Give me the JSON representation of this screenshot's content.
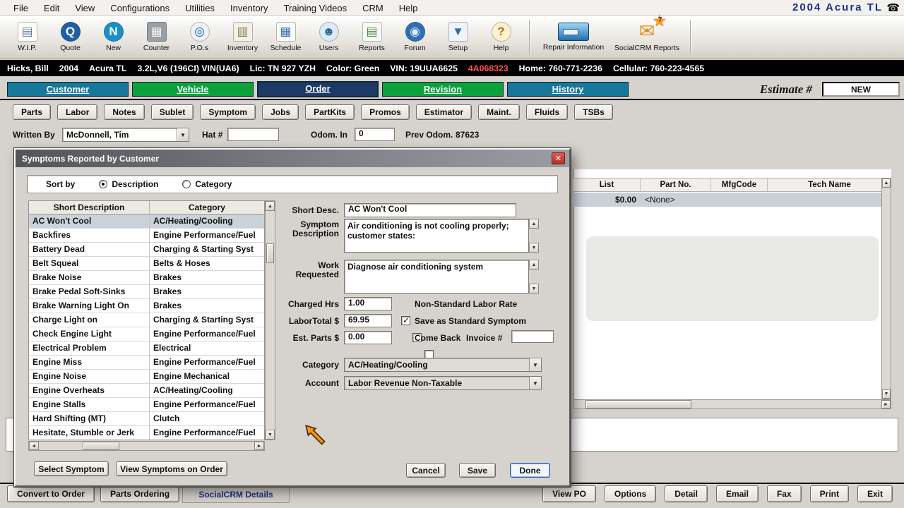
{
  "icons": {
    "dropdown": "▼",
    "up_arrow": "▲",
    "down_arrow": "▼",
    "left_arrow": "◄",
    "right_arrow": "►",
    "close": "✕",
    "phone": "☎",
    "envelope": "✉",
    "star": "★"
  },
  "menu": {
    "items": [
      "File",
      "Edit",
      "View",
      "Configurations",
      "Utilities",
      "Inventory",
      "Training Videos",
      "CRM",
      "Help"
    ],
    "vehicle": "2004  Acura  TL"
  },
  "toolbar": {
    "buttons": [
      {
        "label": "W.I.P.",
        "name": "wip-button",
        "icon_name": "notepad-icon",
        "icon": "▤",
        "bg": "#fdfdf8",
        "fg": "#5b79a8",
        "radius": "3px"
      },
      {
        "label": "Quote",
        "name": "quote-button",
        "icon_name": "quote-icon",
        "icon": "Q",
        "bg": "#1e5fa8",
        "fg": "#ffffff",
        "radius": "50%"
      },
      {
        "label": "New",
        "name": "new-button",
        "icon_name": "new-document-icon",
        "icon": "N",
        "bg": "#1791c8",
        "fg": "#ffffff",
        "radius": "50%"
      },
      {
        "label": "Counter",
        "name": "counter-button",
        "icon_name": "counter-icon",
        "icon": "▦",
        "bg": "#98a0a6",
        "fg": "#f4f4f0",
        "radius": "3px"
      },
      {
        "label": "P.O.s",
        "name": "pos-button",
        "icon_name": "purchase-order-icon",
        "icon": "◎",
        "bg": "#edf2f8",
        "fg": "#1e5fa8",
        "radius": "50%"
      },
      {
        "label": "Inventory",
        "name": "inventory-button",
        "icon_name": "inventory-box-icon",
        "icon": "▥",
        "bg": "#f2f0e8",
        "fg": "#8a7a4a",
        "radius": "3px"
      },
      {
        "label": "Schedule",
        "name": "schedule-button",
        "icon_name": "calendar-icon",
        "icon": "▦",
        "bg": "#f6f8fa",
        "fg": "#3f6fae",
        "radius": "3px"
      },
      {
        "label": "Users",
        "name": "users-button",
        "icon_name": "users-icon",
        "icon": "☻",
        "bg": "#dcebf6",
        "fg": "#2b5f98",
        "radius": "50%"
      },
      {
        "label": "Reports",
        "name": "reports-button",
        "icon_name": "report-icon",
        "icon": "▤",
        "bg": "#f8f8f4",
        "fg": "#4a8a4a",
        "radius": "3px"
      },
      {
        "label": "Forum",
        "name": "forum-button",
        "icon_name": "globe-icon",
        "icon": "◉",
        "bg": "#2e6fb2",
        "fg": "#d8eafc",
        "radius": "50%"
      },
      {
        "label": "Setup",
        "name": "setup-button",
        "icon_name": "funnel-icon",
        "icon": "▼",
        "bg": "#f0f4f8",
        "fg": "#2e6fb2",
        "radius": "3px"
      },
      {
        "label": "Help",
        "name": "help-button",
        "icon_name": "question-icon",
        "icon": "?",
        "bg": "#fdf2cf",
        "fg": "#a8761f",
        "radius": "50%"
      }
    ],
    "repair_info_label": "Repair Information",
    "socialcrm_label": "SocialCRM Reports",
    "socialcrm_badge": "7"
  },
  "customer_bar": {
    "segments": [
      {
        "t": "Hicks, Bill"
      },
      {
        "t": "2004"
      },
      {
        "t": "Acura TL"
      },
      {
        "t": "3.2L,V6 (196CI) VIN(UA6)"
      },
      {
        "t": "Lic:  TN 927 YZH"
      },
      {
        "t": "Color:  Green"
      },
      {
        "t": "VIN:  19UUA6625"
      },
      {
        "t": "4A068323",
        "red": true
      },
      {
        "t": "Home:  760-771-2236"
      },
      {
        "t": "Cellular:  760-223-4565"
      }
    ]
  },
  "main_tabs": [
    {
      "label": "Customer",
      "name": "tab-customer",
      "bg": "#16789b"
    },
    {
      "label": "Vehicle",
      "name": "tab-vehicle",
      "bg": "#0ba23c"
    },
    {
      "label": "Order",
      "name": "tab-order",
      "bg": "#1d3a66",
      "selected": true
    },
    {
      "label": "Revision",
      "name": "tab-revision",
      "bg": "#0ba23c"
    },
    {
      "label": "History",
      "name": "tab-history",
      "bg": "#16789b"
    }
  ],
  "estimate": {
    "label": "Estimate #",
    "value": "NEW"
  },
  "sub_tabs": [
    {
      "label": "Parts",
      "name": "subtab-parts"
    },
    {
      "label": "Labor",
      "name": "subtab-labor"
    },
    {
      "label": "Notes",
      "name": "subtab-notes"
    },
    {
      "label": "Sublet",
      "name": "subtab-sublet"
    },
    {
      "label": "Symptom",
      "name": "subtab-symptom"
    },
    {
      "label": "Jobs",
      "name": "subtab-jobs"
    },
    {
      "label": "PartKits",
      "name": "subtab-partkits"
    },
    {
      "label": "Promos",
      "name": "subtab-promos"
    },
    {
      "label": "Estimator",
      "name": "subtab-estimator"
    },
    {
      "label": "Maint.",
      "name": "subtab-maint"
    },
    {
      "label": "Fluids",
      "name": "subtab-fluids"
    },
    {
      "label": "TSBs",
      "name": "subtab-tsbs"
    }
  ],
  "order_header": {
    "written_by_label": "Written By",
    "written_by_value": "McDonnell, Tim",
    "hat_label": "Hat #",
    "hat_value": "",
    "odom_in_label": "Odom. In",
    "odom_in_value": "0",
    "prev_odom_label": "Prev Odom.",
    "prev_odom_value": "87623"
  },
  "background_grid": {
    "headers": [
      "List",
      "Part No.",
      "MfgCode",
      "Tech Name"
    ],
    "row": {
      "col1": "$0.00",
      "col2": "<None>"
    }
  },
  "dialog": {
    "title": "Symptoms Reported by Customer",
    "sort_label": "Sort by",
    "sort_options": [
      {
        "label": "Description",
        "selected": true
      },
      {
        "label": "Category",
        "selected": false
      }
    ],
    "table": {
      "headers": [
        "Short Description",
        "Category"
      ],
      "rows": [
        {
          "desc": "AC Won't Cool",
          "cat": "AC/Heating/Cooling",
          "selected": true
        },
        {
          "desc": "Backfires",
          "cat": "Engine Performance/Fuel"
        },
        {
          "desc": "Battery Dead",
          "cat": "Charging & Starting Syst"
        },
        {
          "desc": "Belt Squeal",
          "cat": "Belts & Hoses"
        },
        {
          "desc": "Brake Noise",
          "cat": "Brakes"
        },
        {
          "desc": "Brake Pedal Soft-Sinks",
          "cat": "Brakes"
        },
        {
          "desc": "Brake Warning Light On",
          "cat": "Brakes"
        },
        {
          "desc": "Charge Light on",
          "cat": "Charging & Starting Syst"
        },
        {
          "desc": "Check Engine Light",
          "cat": "Engine Performance/Fuel"
        },
        {
          "desc": "Electrical Problem",
          "cat": "Electrical"
        },
        {
          "desc": "Engine Miss",
          "cat": "Engine Performance/Fuel"
        },
        {
          "desc": "Engine Noise",
          "cat": "Engine Mechanical"
        },
        {
          "desc": "Engine Overheats",
          "cat": "AC/Heating/Cooling"
        },
        {
          "desc": "Engine Stalls",
          "cat": "Engine Performance/Fuel"
        },
        {
          "desc": "Hard Shifting (MT)",
          "cat": "Clutch"
        },
        {
          "desc": "Hesitate, Stumble or Jerk",
          "cat": "Engine Performance/Fuel"
        }
      ]
    },
    "form": {
      "short_desc_label": "Short Desc.",
      "short_desc_value": "AC Won't Cool",
      "symptom_desc_label": "Symptom Description",
      "symptom_desc_value": "Air conditioning is not cooling properly; customer states:",
      "work_requested_label": "Work Requested",
      "work_requested_value": "Diagnose air conditioning system",
      "charged_hrs_label": "Charged Hrs",
      "charged_hrs_value": "1.00",
      "labor_total_label": "LaborTotal $",
      "labor_total_value": "69.95",
      "est_parts_label": "Est. Parts $",
      "est_parts_value": "0.00",
      "non_standard_label": "Non-Standard Labor Rate",
      "non_standard_checked": true,
      "save_standard_label": "Save as Standard Symptom",
      "save_standard_checked": false,
      "come_back_label": "Come Back",
      "come_back_checked": false,
      "invoice_label": "Invoice #",
      "invoice_value": "",
      "category_label": "Category",
      "category_value": "AC/Heating/Cooling",
      "account_label": "Account",
      "account_value": "Labor Revenue Non-Taxable"
    },
    "buttons": {
      "cancel": "Cancel",
      "save": "Save",
      "done": "Done",
      "select_symptom": "Select Symptom",
      "view_symptoms": "View Symptoms on Order"
    }
  },
  "bottom_bar": {
    "left": [
      {
        "label": "Convert to Order",
        "name": "convert-to-order-button"
      },
      {
        "label": "Parts Ordering",
        "name": "parts-ordering-button"
      }
    ],
    "socialcrm_details": "SocialCRM Details",
    "right": [
      {
        "label": "View PO",
        "name": "view-po-button"
      },
      {
        "label": "Options",
        "name": "options-button"
      },
      {
        "label": "Detail",
        "name": "detail-button"
      },
      {
        "label": "Email",
        "name": "email-button"
      },
      {
        "label": "Fax",
        "name": "fax-button"
      },
      {
        "label": "Print",
        "name": "print-button"
      },
      {
        "label": "Exit",
        "name": "exit-button"
      }
    ]
  }
}
